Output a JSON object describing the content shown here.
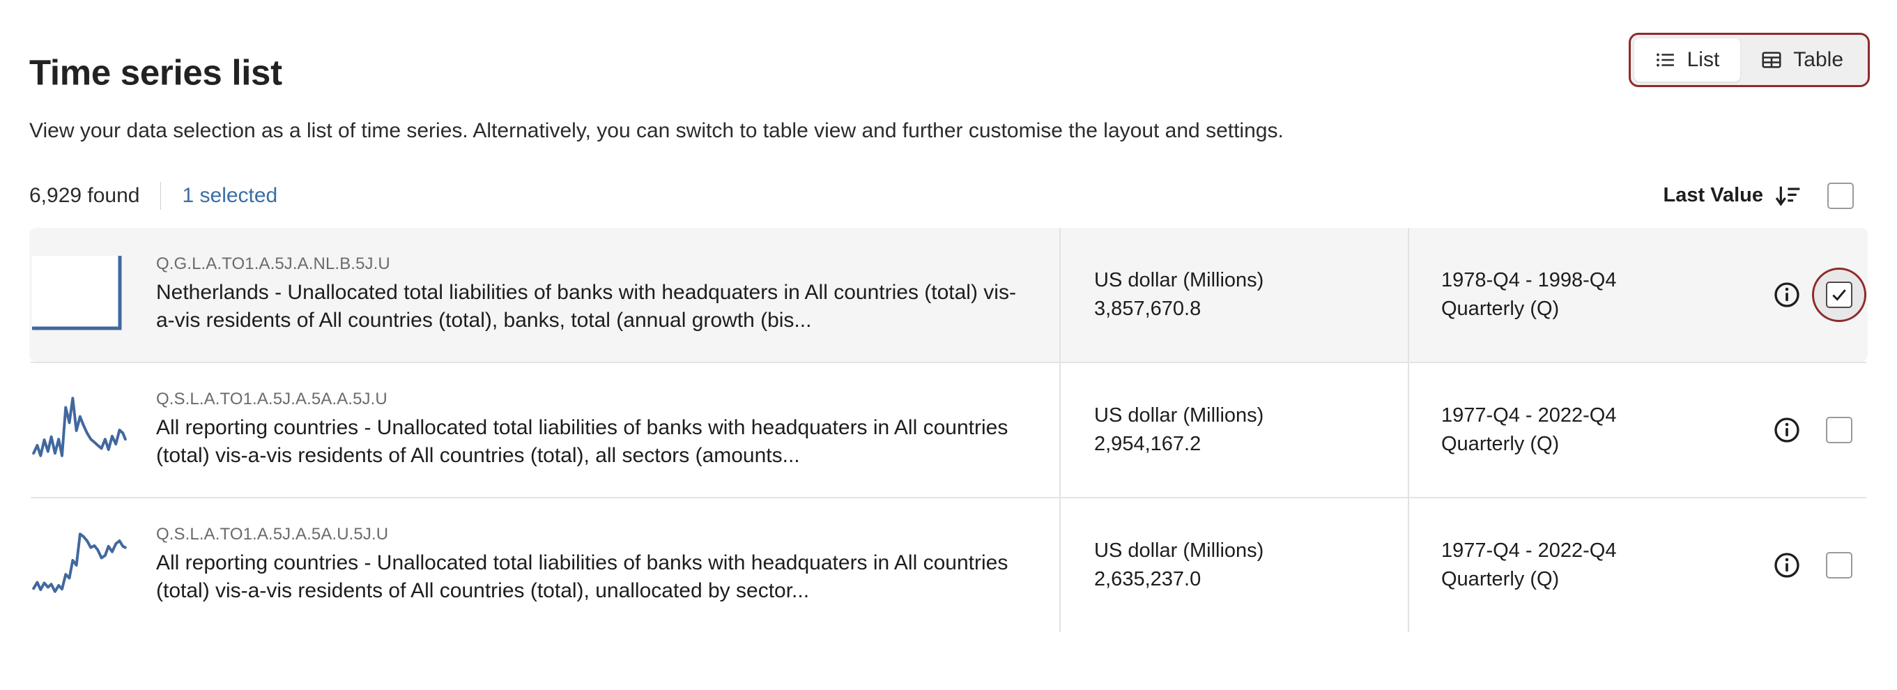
{
  "header": {
    "title": "Time series list",
    "subtitle": "View your data selection as a list of time series. Alternatively, you can switch to table view and further customise the layout and settings.",
    "view_toggle": {
      "list_label": "List",
      "list_icon": "list-icon",
      "table_label": "Table",
      "table_icon": "table-icon",
      "active": "List",
      "highlight_color": "#8f2b2b"
    }
  },
  "meta": {
    "found_label": "6,929 found",
    "selected_label": "1 selected",
    "selected_color": "#3a6ea5",
    "sort_column_label": "Last Value",
    "sort_icon": "sort-descending-icon",
    "select_all_checked": false
  },
  "rows": [
    {
      "key": "Q.G.L.A.TO1.A.5J.A.NL.B.5J.U",
      "title": "Netherlands - Unallocated total liabilities of banks with headquaters in All countries (total) vis-a-vis residents of All countries (total), banks, total (annual growth (bis...",
      "unit": "US dollar (Millions)",
      "last_value": "3,857,670.8",
      "period": "1978-Q4 - 1998-Q4",
      "frequency": "Quarterly (Q)",
      "selected": true,
      "highlighted": true,
      "spark_type": "clipped-box",
      "spark_color": "#41689e"
    },
    {
      "key": "Q.S.L.A.TO1.A.5J.A.5A.A.5J.U",
      "title": "All reporting countries - Unallocated total liabilities of banks with headquaters in All countries (total) vis-a-vis residents of All countries (total), all sectors (amounts...",
      "unit": "US dollar (Millions)",
      "last_value": "2,954,167.2",
      "period": "1977-Q4 - 2022-Q4",
      "frequency": "Quarterly (Q)",
      "selected": false,
      "highlighted": false,
      "spark_type": "line",
      "spark_color": "#41689e"
    },
    {
      "key": "Q.S.L.A.TO1.A.5J.A.5A.U.5J.U",
      "title": "All reporting countries - Unallocated total liabilities of banks with headquaters in All countries (total) vis-a-vis residents of All countries (total), unallocated by sector...",
      "unit": "US dollar (Millions)",
      "last_value": "2,635,237.0",
      "period": "1977-Q4 - 2022-Q4",
      "frequency": "Quarterly (Q)",
      "selected": false,
      "highlighted": false,
      "spark_type": "line",
      "spark_color": "#41689e"
    }
  ],
  "chart_data": [
    {
      "type": "line",
      "title": "Sparkline row 1",
      "note": "flat series clipped at panel edges - only bottom and right axis strokes visible",
      "x": [
        0,
        1
      ],
      "values": [
        0,
        0
      ]
    },
    {
      "type": "line",
      "title": "Sparkline row 2",
      "x": [
        0,
        1,
        2,
        3,
        4,
        5,
        6,
        7,
        8,
        9,
        10,
        11,
        12,
        13,
        14,
        15,
        16,
        17,
        18,
        19,
        20,
        21,
        22,
        23,
        24,
        25,
        26,
        27,
        28,
        29,
        30
      ],
      "values": [
        12,
        24,
        10,
        30,
        14,
        34,
        12,
        30,
        10,
        78,
        56,
        92,
        44,
        62,
        50,
        38,
        30,
        26,
        22,
        18,
        30,
        16,
        34,
        24,
        40,
        36,
        30,
        44,
        52,
        40,
        42
      ]
    },
    {
      "type": "line",
      "title": "Sparkline row 3",
      "x": [
        0,
        1,
        2,
        3,
        4,
        5,
        6,
        7,
        8,
        9,
        10,
        11,
        12,
        13,
        14,
        15,
        16,
        17,
        18,
        19,
        20,
        21,
        22,
        23,
        24,
        25,
        26,
        27,
        28,
        29,
        30
      ],
      "values": [
        18,
        26,
        14,
        24,
        18,
        22,
        12,
        20,
        14,
        40,
        34,
        60,
        92,
        86,
        80,
        72,
        78,
        62,
        58,
        66,
        74,
        62,
        58,
        70,
        76,
        66,
        72,
        84,
        88,
        78,
        80
      ]
    }
  ]
}
